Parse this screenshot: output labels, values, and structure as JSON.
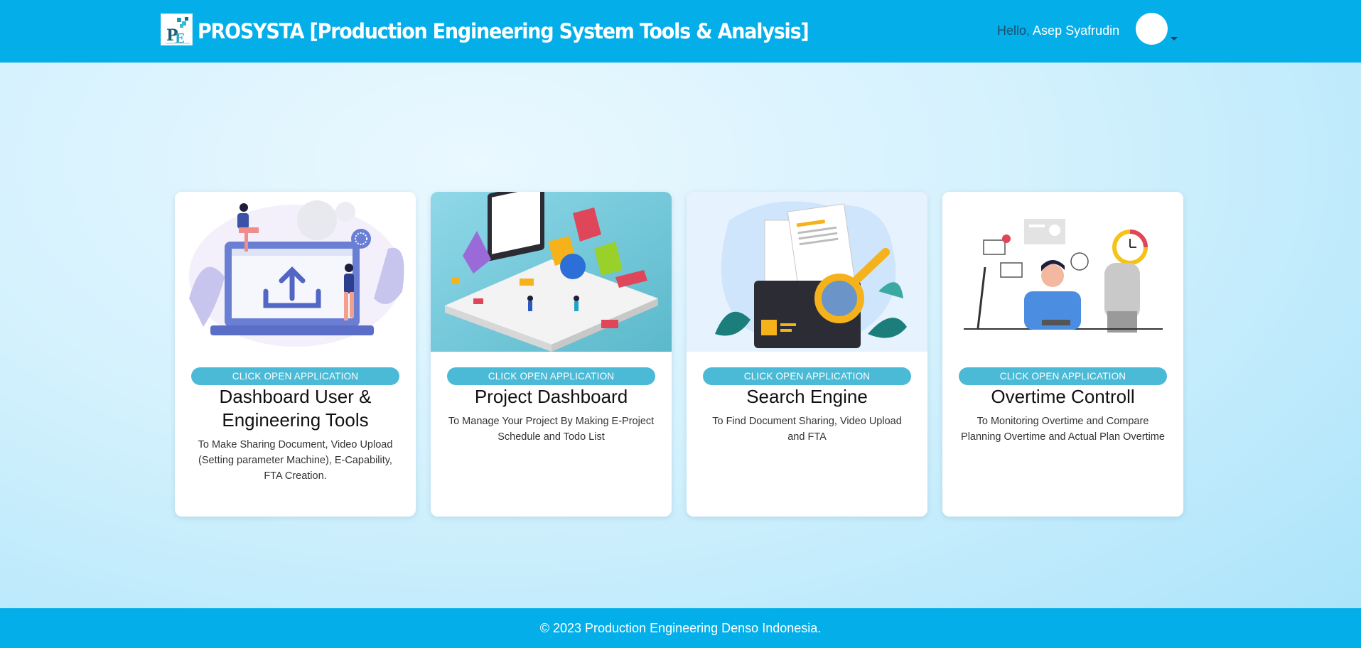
{
  "header": {
    "brand": "PROSYSTA [Production Engineering System Tools & Analysis]",
    "greeting_prefix": "Hello,",
    "user_name": "Asep Syafrudin"
  },
  "cards": [
    {
      "button": "CLICK OPEN APPLICATION",
      "title": "Dashboard User & Engineering Tools",
      "description": "To Make Sharing Document, Video Upload (Setting parameter Machine), E-Capability, FTA Creation.",
      "illustration": "upload-laptop-illustration"
    },
    {
      "button": "CLICK OPEN APPLICATION",
      "title": "Project Dashboard",
      "description": "To Manage Your Project By Making E-Project Schedule and Todo List",
      "illustration": "isometric-project-illustration"
    },
    {
      "button": "CLICK OPEN APPLICATION",
      "title": "Search Engine",
      "description": "To Find Document Sharing, Video Upload and FTA",
      "illustration": "document-search-illustration"
    },
    {
      "button": "CLICK OPEN APPLICATION",
      "title": "Overtime Controll",
      "description": "To Monitoring Overtime and Compare Planning Overtime and Actual Plan Overtime",
      "illustration": "overtime-clock-illustration"
    }
  ],
  "footer": {
    "text": "© 2023 Production Engineering Denso Indonesia."
  },
  "colors": {
    "header_bg": "#03aee9",
    "button_bg": "#4bbad6",
    "footer_bg": "#03aee9"
  }
}
